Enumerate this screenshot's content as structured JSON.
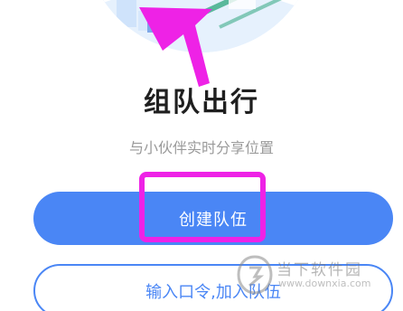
{
  "title": "组队出行",
  "subtitle": "与小伙伴实时分享位置",
  "buttons": {
    "create_team": "创建队伍",
    "join_team": "输入口令,加入队伍"
  },
  "watermark": {
    "name": "当下软件园",
    "url": "www.downxia.com"
  },
  "colors": {
    "primary": "#4a86f5",
    "annotation": "#ee22e6"
  },
  "annotations": {
    "arrow": "magenta-arrow-icon",
    "highlight": "magenta-highlight-box"
  }
}
